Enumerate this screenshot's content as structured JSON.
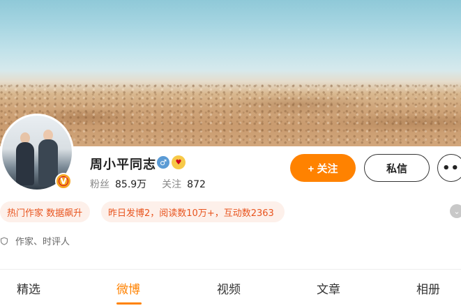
{
  "profile": {
    "name": "周小平同志",
    "fans_label": "粉丝",
    "fans_count": "85.9万",
    "following_label": "关注",
    "following_count": "872",
    "description": "作家、时评人"
  },
  "actions": {
    "follow_label": "+ 关注",
    "message_label": "私信",
    "more_label": "•••"
  },
  "tags": [
    "热门作家 数据飙升",
    "昨日发博2，阅读数10万+，互动数2363"
  ],
  "tabs": [
    {
      "label": "精选"
    },
    {
      "label": "微博"
    },
    {
      "label": "视频"
    },
    {
      "label": "文章"
    },
    {
      "label": "相册"
    }
  ],
  "active_tab": "微博",
  "icons": {
    "verified_badge": "v-verified-icon",
    "gender": "male-icon",
    "emoji": "fan-emoji-icon",
    "expand": "chevron-down-icon",
    "description": "shield-icon"
  },
  "colors": {
    "accent": "#ff8200",
    "tag_bg": "#fdf0ea",
    "tag_text": "#e8541e"
  }
}
